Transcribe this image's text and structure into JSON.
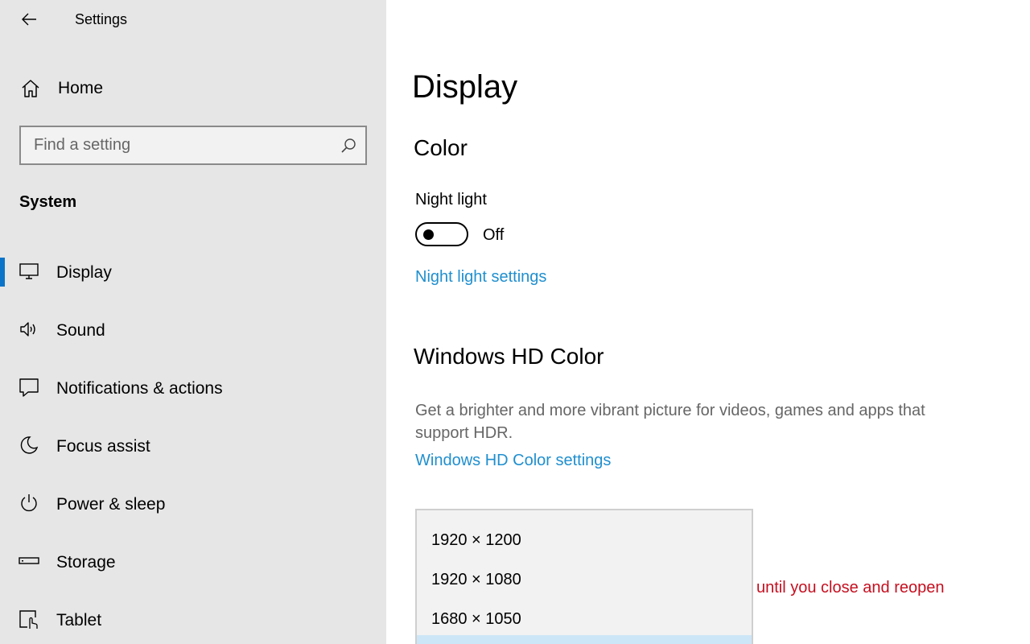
{
  "window": {
    "title": "Settings"
  },
  "sidebar": {
    "home_label": "Home",
    "search_placeholder": "Find a setting",
    "section": "System",
    "items": [
      {
        "label": "Display",
        "icon": "monitor-icon",
        "active": true
      },
      {
        "label": "Sound",
        "icon": "speaker-icon"
      },
      {
        "label": "Notifications & actions",
        "icon": "message-icon"
      },
      {
        "label": "Focus assist",
        "icon": "moon-icon"
      },
      {
        "label": "Power & sleep",
        "icon": "power-icon"
      },
      {
        "label": "Storage",
        "icon": "storage-icon"
      },
      {
        "label": "Tablet",
        "icon": "tablet-icon"
      }
    ]
  },
  "main": {
    "title": "Display",
    "color": {
      "heading": "Color",
      "night_light_label": "Night light",
      "night_light_state": "Off",
      "night_light_link": "Night light settings"
    },
    "hd_color": {
      "heading": "Windows HD Color",
      "description": "Get a brighter and more vibrant picture for videos, games and apps that support HDR.",
      "link": "Windows HD Color settings"
    },
    "resolution_dropdown": {
      "options": [
        "1920 × 1200",
        "1920 × 1080",
        "1680 × 1050"
      ]
    },
    "warning_text": "until you close and reopen"
  },
  "colors": {
    "accent": "#0a74c9",
    "link": "#1f8fcf",
    "warning": "#c50f1f",
    "sidebar_bg": "#e6e6e6"
  }
}
